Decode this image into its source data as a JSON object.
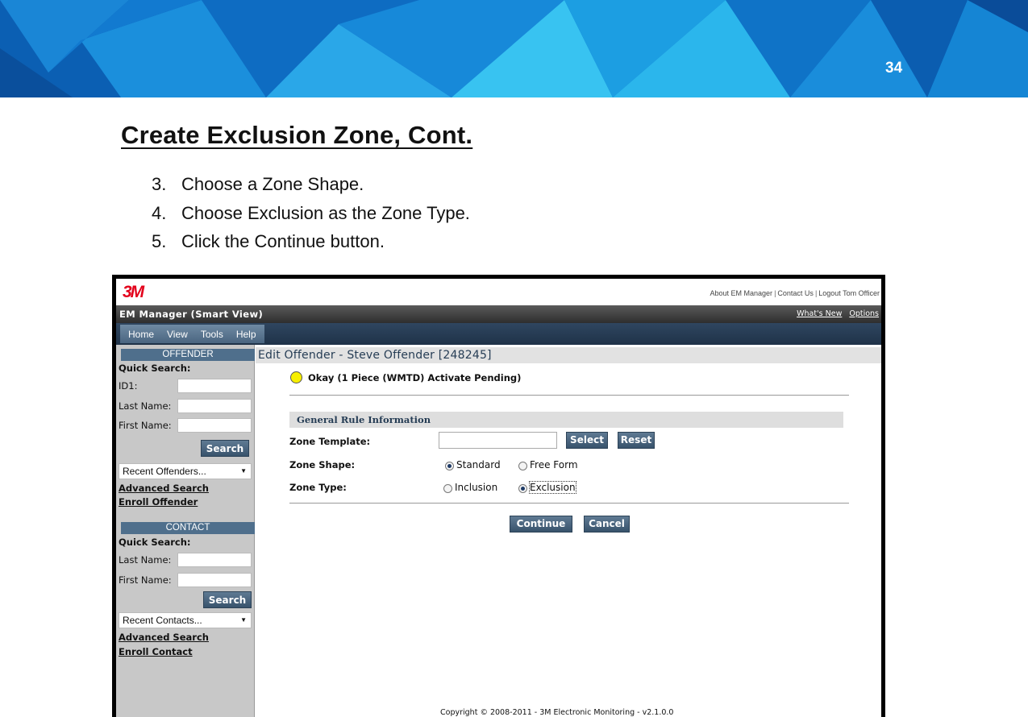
{
  "slide": {
    "number": "34",
    "title": "Create Exclusion Zone, Cont.",
    "steps": [
      {
        "num": "3.",
        "text": "Choose a Zone Shape."
      },
      {
        "num": "4.",
        "text": "Choose Exclusion as the Zone Type."
      },
      {
        "num": "5.",
        "text": "Click the Continue button."
      }
    ]
  },
  "app": {
    "logo": "3M",
    "top_links": [
      "About EM Manager",
      "Contact Us",
      "Logout Tom Officer"
    ],
    "name": "EM Manager (Smart View)",
    "bar_links": [
      "What's New",
      "Options"
    ],
    "menu": [
      "Home",
      "View",
      "Tools",
      "Help"
    ]
  },
  "sidebar": {
    "offender": {
      "header": "OFFENDER",
      "quick_search": "Quick Search:",
      "fields": [
        {
          "label": "ID1:",
          "value": ""
        },
        {
          "label": "Last Name:",
          "value": ""
        },
        {
          "label": "First Name:",
          "value": ""
        }
      ],
      "search_button": "Search",
      "recent": "Recent Offenders...",
      "links": [
        "Advanced Search",
        "Enroll Offender"
      ]
    },
    "contact": {
      "header": "CONTACT",
      "quick_search": "Quick Search:",
      "fields": [
        {
          "label": "Last Name:",
          "value": ""
        },
        {
          "label": "First Name:",
          "value": ""
        }
      ],
      "search_button": "Search",
      "recent": "Recent Contacts...",
      "links": [
        "Advanced Search",
        "Enroll Contact"
      ]
    }
  },
  "main": {
    "title": "Edit Offender - Steve Offender [248245]",
    "status": "Okay (1 Piece (WMTD) Activate Pending)",
    "status_color": "#f7ef00",
    "section": "General Rule Information",
    "zone_template": {
      "label": "Zone Template:",
      "value": "",
      "select_button": "Select",
      "reset_button": "Reset"
    },
    "zone_shape": {
      "label": "Zone Shape:",
      "options": [
        "Standard",
        "Free Form"
      ],
      "selected": "Standard"
    },
    "zone_type": {
      "label": "Zone Type:",
      "options": [
        "Inclusion",
        "Exclusion"
      ],
      "selected": "Exclusion"
    },
    "continue_button": "Continue",
    "cancel_button": "Cancel",
    "copyright": "Copyright © 2008-2011 - 3M Electronic Monitoring - v2.1.0.0"
  }
}
